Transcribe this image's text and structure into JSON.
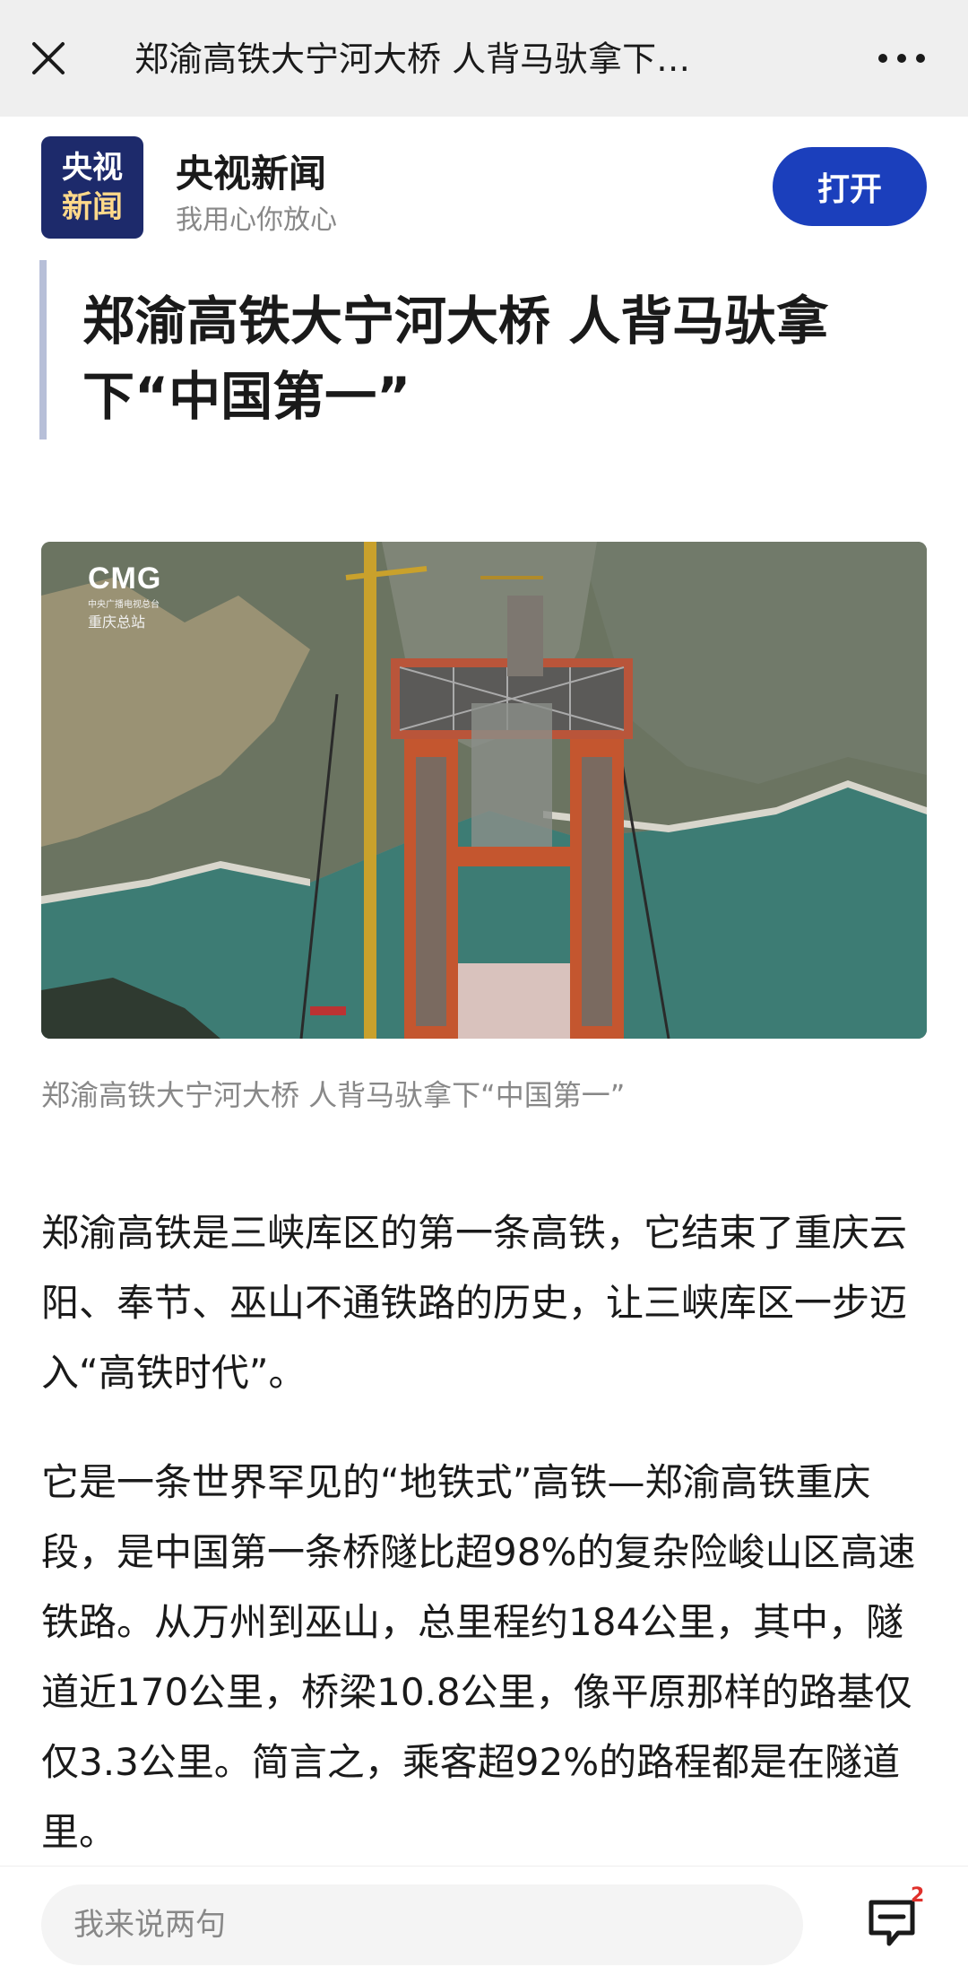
{
  "nav": {
    "title": "郑渝高铁大宁河大桥 人背马驮拿下…",
    "close_icon": "close-icon",
    "more_icon": "more-icon"
  },
  "app": {
    "logo_line1": "央视",
    "logo_line2": "新闻",
    "name": "央视新闻",
    "slogan": "我用心你放心",
    "open_label": "打开"
  },
  "article": {
    "title": "郑渝高铁大宁河大桥 人背马驮拿下“中国第一”",
    "image_watermark": "CMG",
    "image_watermark_sub": "中央广播电视总台",
    "image_watermark_station": "重庆总站",
    "caption": "郑渝高铁大宁河大桥 人背马驮拿下“中国第一”",
    "paragraphs": [
      "郑渝高铁是三峡库区的第一条高铁，它结束了重庆云阳、奉节、巫山不通铁路的历史，让三峡库区一步迈入“高铁时代”。",
      "它是一条世界罕见的“地铁式”高铁—郑渝高铁重庆段，是中国第一条桥隧比超98%的复杂险峻山区高速铁路。从万州到巫山，总里程约184公里，其中，隧道近170公里，桥梁10.8公里，像平原那样的路基仅仅3.3公里。简言之，乘客超92%的路程都是在隧道里。"
    ]
  },
  "bottom": {
    "comment_placeholder": "我来说两句",
    "comment_count": "2",
    "comment_icon": "comment-icon"
  },
  "colors": {
    "accent": "#1b3fbc",
    "logo_bg": "#1d2a6b",
    "badge": "#e0302b"
  }
}
